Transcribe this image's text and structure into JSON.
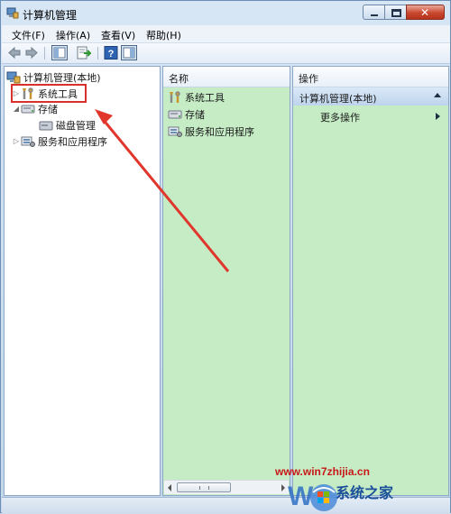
{
  "window": {
    "title": "计算机管理",
    "controls": {
      "minimize": "minimize",
      "maximize": "maximize",
      "close": "close"
    }
  },
  "menu": [
    "文件(F)",
    "操作(A)",
    "查看(V)",
    "帮助(H)"
  ],
  "toolbar": {
    "icons": [
      "back-arrow-icon",
      "forward-arrow-icon",
      "show-hide-tree-icon",
      "export-list-icon",
      "help-icon",
      "properties-icon"
    ]
  },
  "tree": {
    "root": "计算机管理(本地)",
    "items": [
      {
        "label": "系统工具",
        "level": 1,
        "expander": "▷",
        "icon": "tools-icon"
      },
      {
        "label": "存储",
        "level": 1,
        "expander": "◢",
        "icon": "storage-icon"
      },
      {
        "label": "磁盘管理",
        "level": 2,
        "expander": "",
        "icon": "disk-icon"
      },
      {
        "label": "服务和应用程序",
        "level": 1,
        "expander": "▷",
        "icon": "services-icon"
      }
    ]
  },
  "content": {
    "column_header": "名称",
    "items": [
      "系统工具",
      "存储",
      "服务和应用程序"
    ]
  },
  "actions": {
    "header": "操作",
    "group": "计算机管理(本地)",
    "more": "更多操作"
  },
  "watermark": {
    "url": "www.win7zhijia.cn",
    "site": "系统之家"
  },
  "colors": {
    "pane_bg": "#c5ecc5",
    "highlight": "#d9302b",
    "chrome": "#c9dcef"
  }
}
